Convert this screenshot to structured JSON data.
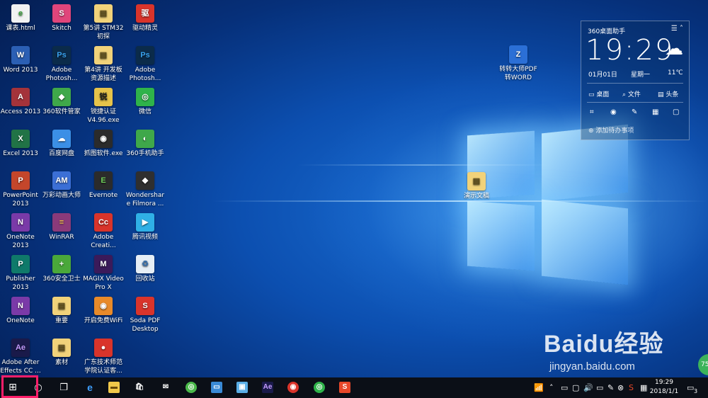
{
  "desktop_icons": [
    {
      "label": "课表.html",
      "glyph": "e",
      "bg": "#f2f2f2",
      "fg": "#3aa43a"
    },
    {
      "label": "Skitch",
      "glyph": "S",
      "bg": "#e0457b",
      "fg": "#ffffff"
    },
    {
      "label": "第5讲 STM32初探",
      "glyph": "▤",
      "bg": "#f1d27a",
      "fg": "#5a4a1a"
    },
    {
      "label": "驱动精灵",
      "glyph": "驱",
      "bg": "#d9342b",
      "fg": "#ffffff"
    },
    {
      "label": "Word 2013",
      "glyph": "W",
      "bg": "#2b5fb4",
      "fg": "#ffffff"
    },
    {
      "label": "Adobe Photosh...",
      "glyph": "Ps",
      "bg": "#0b2b4a",
      "fg": "#39a3f0"
    },
    {
      "label": "第4讲 开发板资源描述",
      "glyph": "▤",
      "bg": "#f1d27a",
      "fg": "#5a4a1a"
    },
    {
      "label": "Adobe Photosh...",
      "glyph": "Ps",
      "bg": "#0b2b4a",
      "fg": "#39a3f0"
    },
    {
      "label": "Access 2013",
      "glyph": "A",
      "bg": "#a4333a",
      "fg": "#ffffff"
    },
    {
      "label": "360软件管家",
      "glyph": "◆",
      "bg": "#3fa84a",
      "fg": "#ffffff"
    },
    {
      "label": "锐捷认证V4.96.exe",
      "glyph": "锐",
      "bg": "#e6c34a",
      "fg": "#1b1b1b"
    },
    {
      "label": "微信",
      "glyph": "◎",
      "bg": "#2fb34a",
      "fg": "#ffffff"
    },
    {
      "label": "Excel 2013",
      "glyph": "X",
      "bg": "#217346",
      "fg": "#ffffff"
    },
    {
      "label": "百度网盘",
      "glyph": "☁",
      "bg": "#3b8fe6",
      "fg": "#ffffff"
    },
    {
      "label": "抓图软件.exe",
      "glyph": "◉",
      "bg": "#2b2b2b",
      "fg": "#ffffff"
    },
    {
      "label": "360手机助手",
      "glyph": "◐",
      "bg": "#3fa84a",
      "fg": "#ffffff"
    },
    {
      "label": "PowerPoint 2013",
      "glyph": "P",
      "bg": "#c4462b",
      "fg": "#ffffff"
    },
    {
      "label": "万彩动画大师",
      "glyph": "AM",
      "bg": "#3b6fd6",
      "fg": "#ffffff"
    },
    {
      "label": "Evernote",
      "glyph": "E",
      "bg": "#2b2b2b",
      "fg": "#6fcf5a"
    },
    {
      "label": "Wondershare Filmora ...",
      "glyph": "◆",
      "bg": "#2f2f2f",
      "fg": "#ffffff"
    },
    {
      "label": "OneNote 2013",
      "glyph": "N",
      "bg": "#7a3aa8",
      "fg": "#ffffff"
    },
    {
      "label": "WinRAR",
      "glyph": "≡",
      "bg": "#8a3a7a",
      "fg": "#ffd34a"
    },
    {
      "label": "Adobe Creati...",
      "glyph": "Cc",
      "bg": "#d9342b",
      "fg": "#ffffff"
    },
    {
      "label": "腾讯视频",
      "glyph": "▶",
      "bg": "#2fb0e6",
      "fg": "#ffffff"
    },
    {
      "label": "Publisher 2013",
      "glyph": "P",
      "bg": "#0f7a6a",
      "fg": "#ffffff"
    },
    {
      "label": "360安全卫士",
      "glyph": "+",
      "bg": "#4aa83a",
      "fg": "#ffffff"
    },
    {
      "label": "MAGIX Video Pro X",
      "glyph": "M",
      "bg": "#3a1a5a",
      "fg": "#ffffff"
    },
    {
      "label": "回收站",
      "glyph": "♻",
      "bg": "#e6eef6",
      "fg": "#3a6fa8"
    },
    {
      "label": "OneNote",
      "glyph": "N",
      "bg": "#7a3aa8",
      "fg": "#ffffff"
    },
    {
      "label": "重要",
      "glyph": "▤",
      "bg": "#f1d27a",
      "fg": "#5a4a1a"
    },
    {
      "label": "开启免费WiFi",
      "glyph": "◉",
      "bg": "#e88a2a",
      "fg": "#ffffff"
    },
    {
      "label": "Soda PDF Desktop",
      "glyph": "S",
      "bg": "#d9342b",
      "fg": "#ffffff"
    },
    {
      "label": "Adobe After Effects CC ...",
      "glyph": "Ae",
      "bg": "#1a1a4a",
      "fg": "#c49bff"
    },
    {
      "label": "素材",
      "glyph": "▤",
      "bg": "#f1d27a",
      "fg": "#5a4a1a"
    },
    {
      "label": "广东技术师范学院认证客...",
      "glyph": "●",
      "bg": "#d9342b",
      "fg": "#ffffff"
    }
  ],
  "extra_icons": [
    {
      "label": "转转大师PDF转WORD",
      "glyph": "Z",
      "bg": "#2b6fd6",
      "fg": "#ffffff"
    },
    {
      "label": "演示文稿",
      "glyph": "▤",
      "bg": "#f1d27a",
      "fg": "#5a4a1a"
    }
  ],
  "widget": {
    "title": "360桌面助手",
    "menu_icon": "☰ ˄",
    "time": "19:29",
    "date": "01月01日",
    "weekday": "星期一",
    "temperature": "11℃",
    "buttons": [
      "桌面",
      "文件",
      "头条"
    ],
    "todo": "添加待办事项"
  },
  "taskbar": {
    "time": "19:29",
    "date": "2018/1/1",
    "notification_count": "3"
  },
  "watermark": {
    "brand": "Baidu经验",
    "url": "jingyan.baidu.com",
    "badge": "75"
  },
  "colors": {
    "highlight": "#ff1e6a",
    "taskbar": "#0b0f17"
  }
}
